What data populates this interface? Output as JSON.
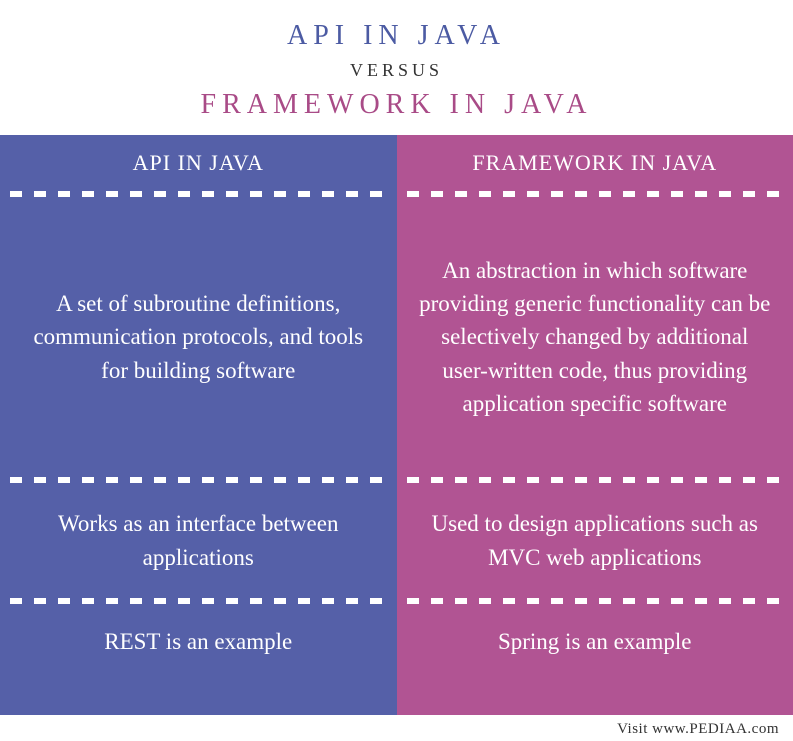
{
  "header": {
    "title_top": "API IN JAVA",
    "versus": "VERSUS",
    "title_bottom": "FRAMEWORK IN JAVA"
  },
  "left": {
    "label": "API IN JAVA",
    "definition": "A set of subroutine definitions, communication protocols, and tools for building software",
    "usage": "Works as an interface between applications",
    "example": "REST is an example"
  },
  "right": {
    "label": "FRAMEWORK IN JAVA",
    "definition": "An abstraction in which software providing generic functionality can be selectively changed by additional user-written code, thus providing application specific software",
    "usage": "Used to design applications such as MVC web applications",
    "example": "Spring is an example"
  },
  "footer": "Visit www.PEDIAA.com"
}
